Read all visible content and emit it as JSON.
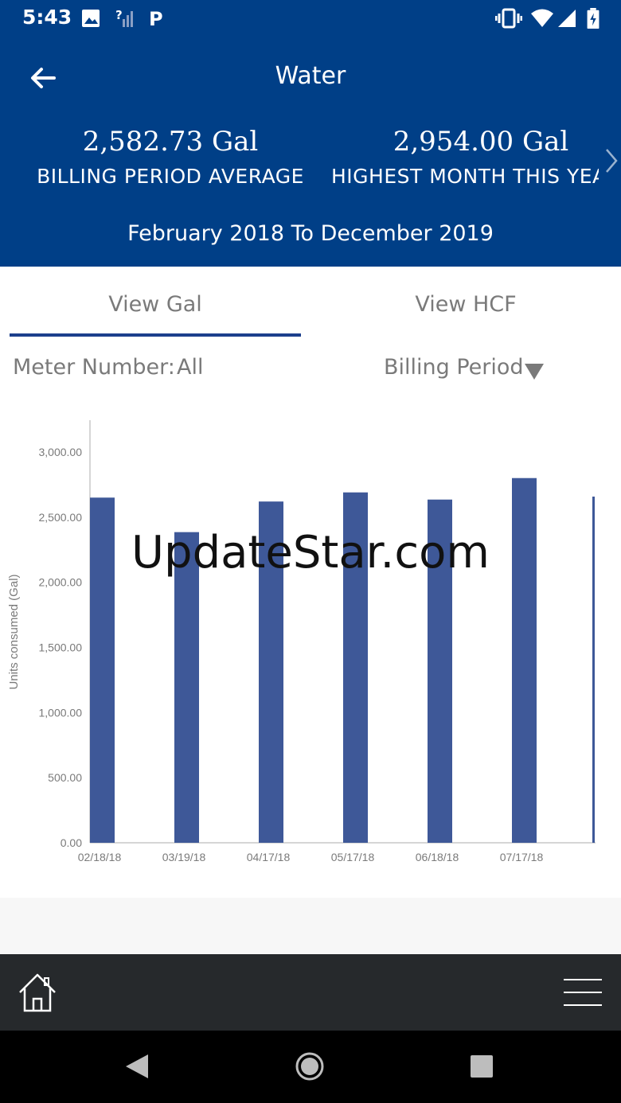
{
  "status_bar": {
    "time": "5:43",
    "icons": [
      "image-icon",
      "no-signal-icon",
      "parking-icon",
      "vibrate-icon",
      "wifi-icon",
      "cell-signal-icon",
      "battery-charging-icon"
    ]
  },
  "header": {
    "title": "Water",
    "stats": [
      {
        "value": "2,582.73 Gal",
        "label": "BILLING PERIOD AVERAGE"
      },
      {
        "value": "2,954.00 Gal",
        "label": "HIGHEST MONTH THIS YEA"
      }
    ],
    "date_range": "February 2018 To December 2019",
    "background": "#003f87"
  },
  "tabs": [
    {
      "label": "View Gal",
      "active": true
    },
    {
      "label": "View HCF",
      "active": false
    }
  ],
  "filters": {
    "meter_label": "Meter Number:",
    "meter_value": "All",
    "period_label": "Billing Period"
  },
  "chart_data": {
    "type": "bar",
    "categories": [
      "02/18/18",
      "03/19/18",
      "04/17/18",
      "05/17/18",
      "06/18/18",
      "07/17/18"
    ],
    "values": [
      2650,
      2385,
      2620,
      2690,
      2635,
      2800
    ],
    "ylabel": "Units consumed (Gal)",
    "ylim": [
      0,
      3000
    ],
    "yticks": [
      "0.00",
      "500.00",
      "1,000.00",
      "1,500.00",
      "2,000.00",
      "2,500.00",
      "3,000.00"
    ],
    "bar_color": "#3e5898",
    "grid": false
  },
  "watermark": "UpdateStar.com",
  "bottom_nav": {
    "icons": [
      "home-icon",
      "menu-icon"
    ]
  },
  "android_nav": {
    "icons": [
      "back-triangle-icon",
      "home-circle-icon",
      "recents-square-icon"
    ]
  }
}
